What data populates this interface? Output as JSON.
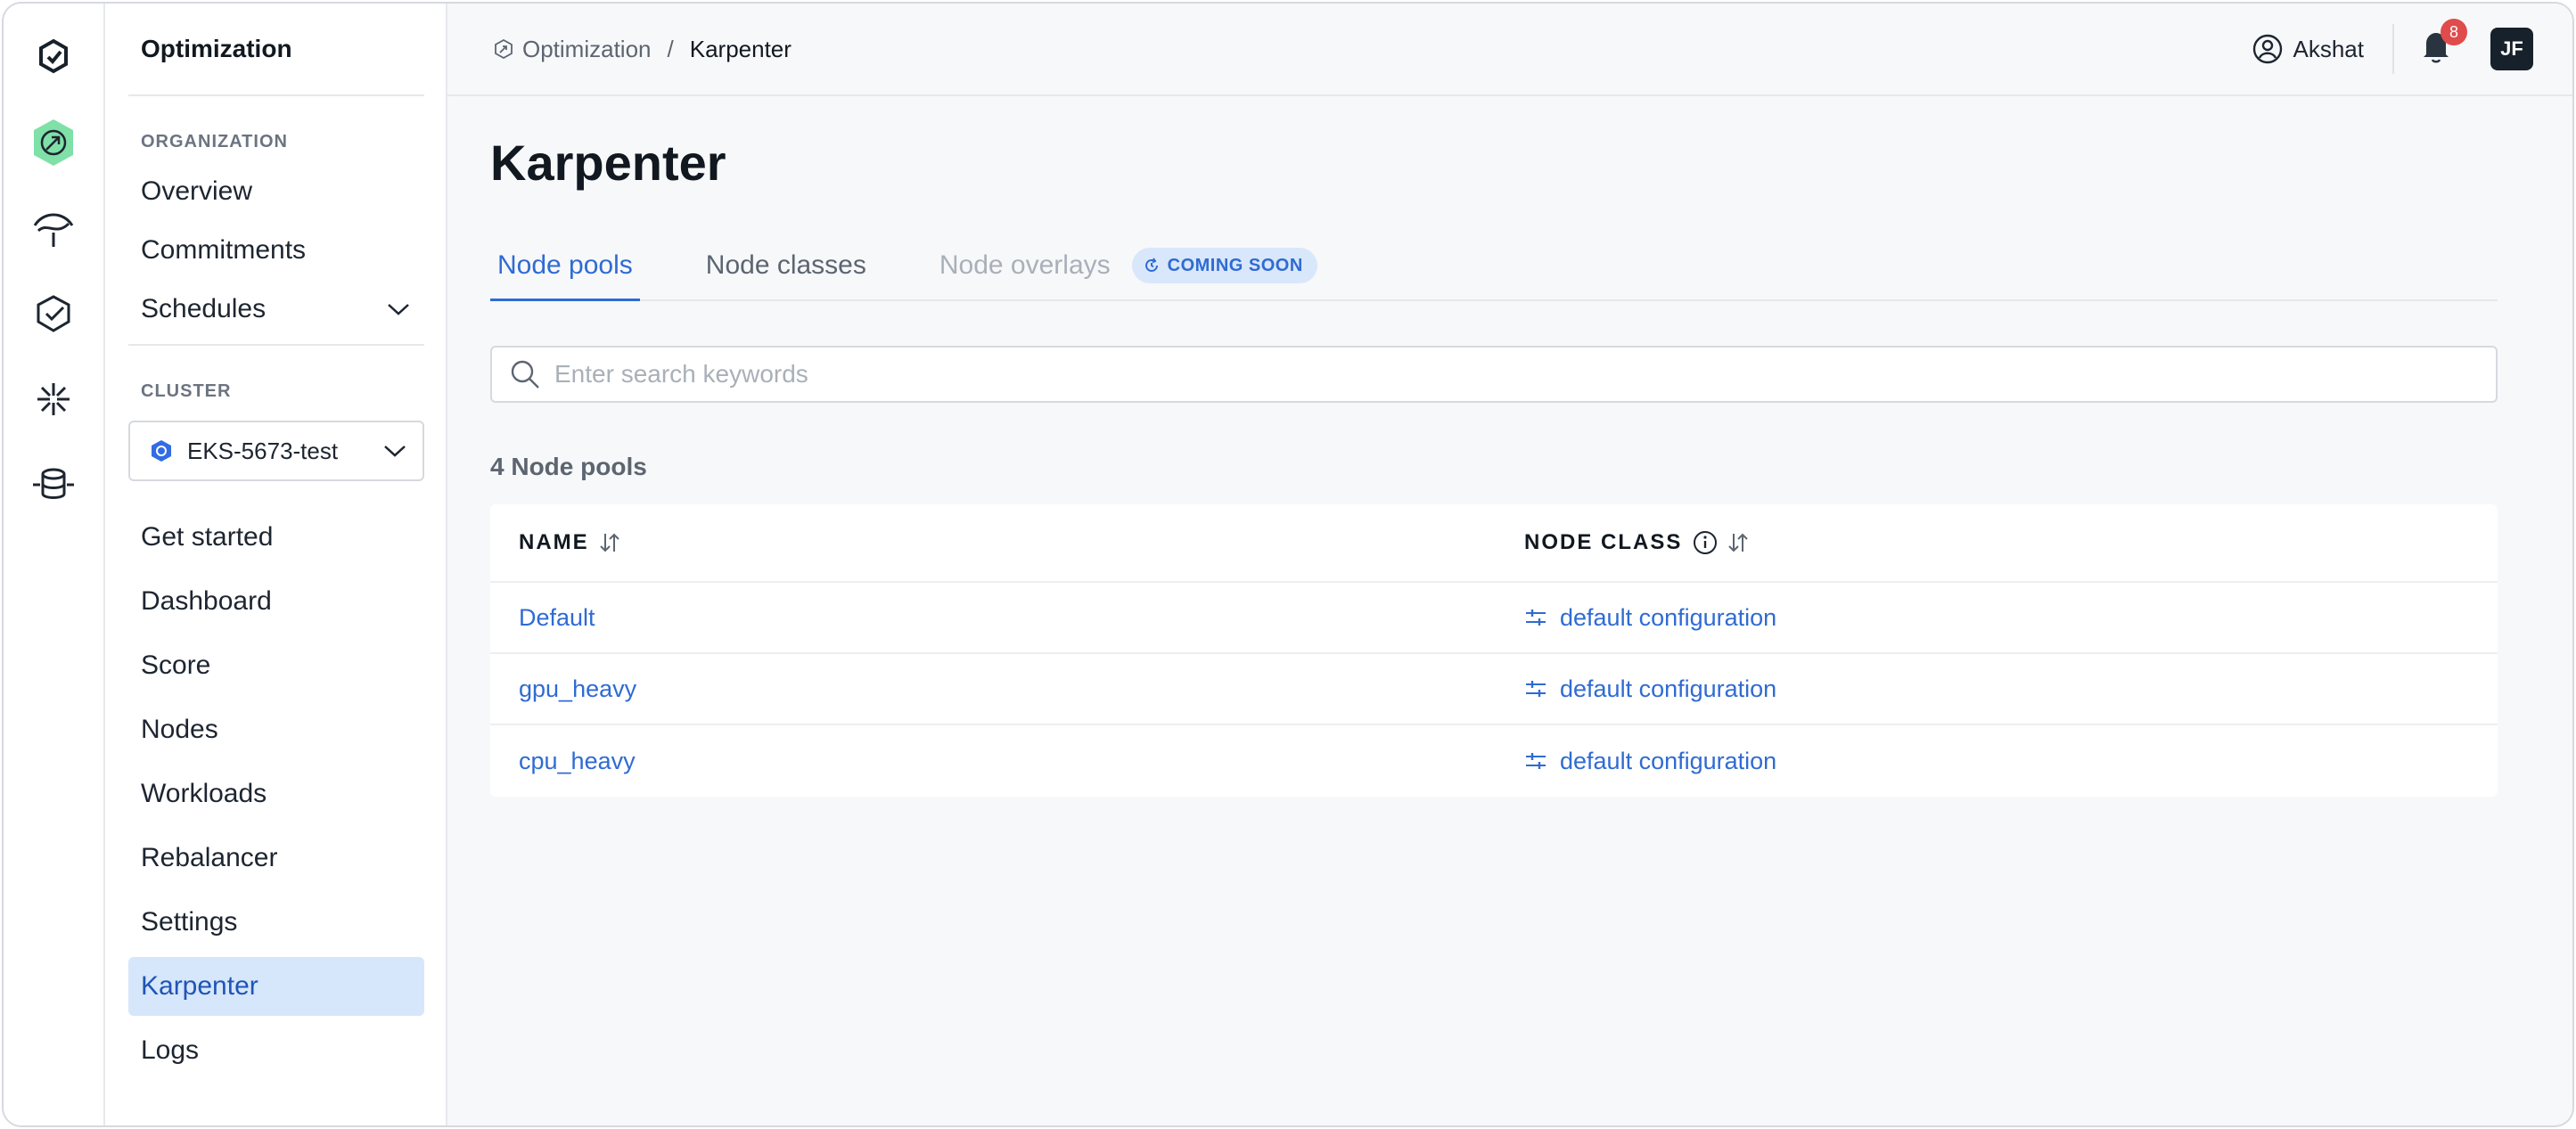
{
  "subnav": {
    "title": "Optimization",
    "org_label": "ORGANIZATION",
    "org_items": [
      "Overview",
      "Commitments",
      "Schedules"
    ],
    "cluster_label": "CLUSTER",
    "cluster_value": "EKS-5673-test",
    "cluster_items": [
      "Get started",
      "Dashboard",
      "Score",
      "Nodes",
      "Workloads",
      "Rebalancer",
      "Settings",
      "Karpenter",
      "Logs"
    ],
    "active_item": "Karpenter"
  },
  "topbar": {
    "breadcrumb_root": "Optimization",
    "breadcrumb_sep": "/",
    "breadcrumb_current": "Karpenter",
    "user_name": "Akshat",
    "notification_count": "8",
    "avatar_initials": "JF"
  },
  "page": {
    "title": "Karpenter",
    "tabs": [
      "Node pools",
      "Node classes",
      "Node overlays"
    ],
    "coming_soon": "COMING SOON",
    "search_placeholder": "Enter search keywords",
    "count_label": "4 Node pools"
  },
  "table": {
    "headers": [
      "NAME",
      "NODE CLASS"
    ],
    "rows": [
      {
        "name": "Default",
        "node_class": "default configuration"
      },
      {
        "name": "gpu_heavy",
        "node_class": "default configuration"
      },
      {
        "name": "cpu_heavy",
        "node_class": "default configuration"
      }
    ]
  },
  "colors": {
    "accent": "#2f6bd3",
    "active_bg": "#d6e6fb",
    "brand_green": "#4fce8c",
    "badge_red": "#e04b4b"
  }
}
